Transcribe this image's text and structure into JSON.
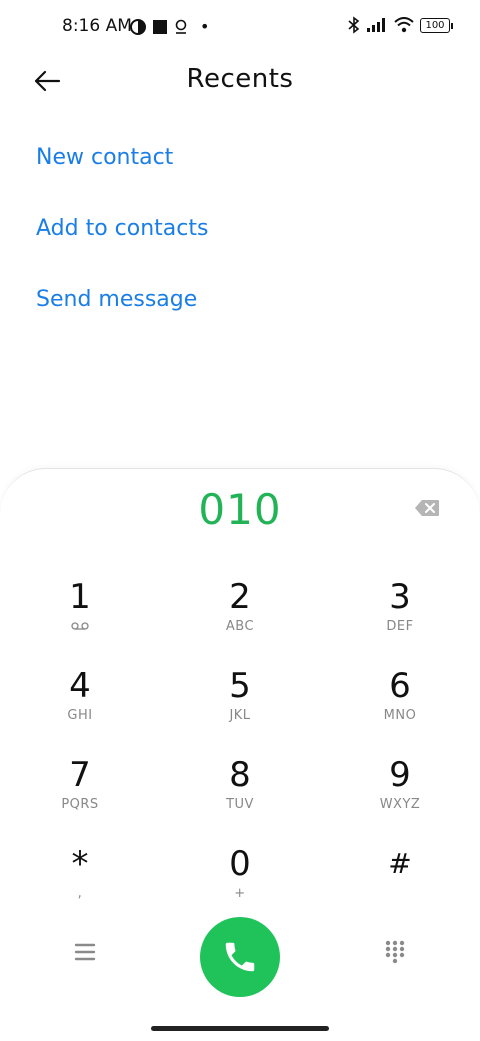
{
  "status_bar": {
    "time": "8:16 AM",
    "battery": "100"
  },
  "header": {
    "title": "Recents"
  },
  "actions": [
    {
      "label": "New contact"
    },
    {
      "label": "Add to contacts"
    },
    {
      "label": "Send message"
    }
  ],
  "dialer": {
    "number": "010",
    "keys": [
      {
        "digit": "1",
        "letters": ""
      },
      {
        "digit": "2",
        "letters": "ABC"
      },
      {
        "digit": "3",
        "letters": "DEF"
      },
      {
        "digit": "4",
        "letters": "GHI"
      },
      {
        "digit": "5",
        "letters": "JKL"
      },
      {
        "digit": "6",
        "letters": "MNO"
      },
      {
        "digit": "7",
        "letters": "PQRS"
      },
      {
        "digit": "8",
        "letters": "TUV"
      },
      {
        "digit": "9",
        "letters": "WXYZ"
      },
      {
        "digit": "*",
        "letters": ","
      },
      {
        "digit": "0",
        "letters": "+"
      },
      {
        "digit": "#",
        "letters": ""
      }
    ]
  },
  "colors": {
    "accent_blue": "#1a7ee6",
    "number_green": "#22b357",
    "call_green": "#1fc35a"
  },
  "icons": {
    "back": "arrow-left-icon",
    "backspace": "backspace-icon",
    "voicemail": "voicemail-icon",
    "menu": "menu-icon",
    "call": "phone-icon",
    "dialpad": "dialpad-grid-icon"
  }
}
